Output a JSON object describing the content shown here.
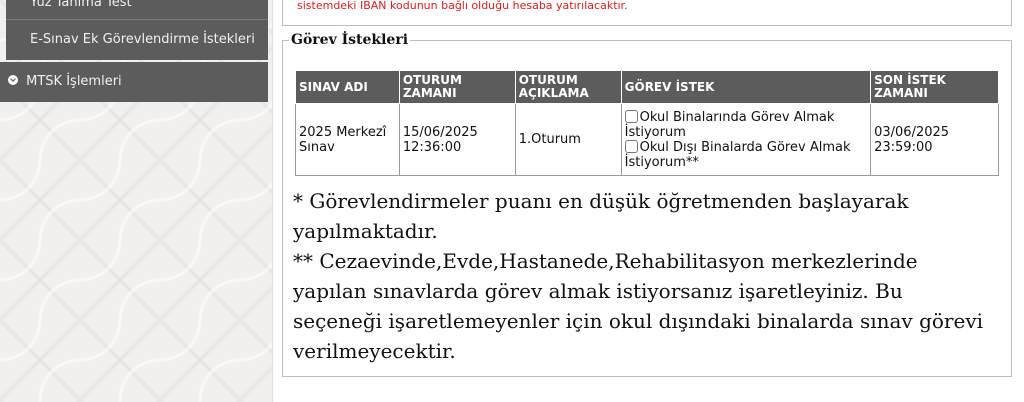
{
  "sidebar": {
    "items": [
      {
        "label": "Yüz Tanıma Test"
      },
      {
        "label": "E-Sınav Ek Görevlendirme İstekleri"
      }
    ],
    "mtsk": {
      "label": "MTSK İşlemleri"
    }
  },
  "notice": {
    "text": "sistemdeki IBAN kodunun bağlı olduğu hesaba yatırılacaktır."
  },
  "gorev_istekleri": {
    "legend": "Görev İstekleri",
    "columns": [
      "SINAV ADI",
      "OTURUM ZAMANI",
      "OTURUM AÇIKLAMA",
      "GÖREV İSTEK",
      "SON İSTEK ZAMANI"
    ],
    "rows": [
      {
        "sinav_adi": "2025 Merkezî Sınav",
        "oturum_zamani": "15/06/2025 12:36:00",
        "oturum_aciklama": "1.Oturum",
        "options": [
          {
            "label": "Okul Binalarında Görev Almak İstiyorum",
            "checked": false
          },
          {
            "label": "Okul Dışı Binalarda Görev Almak İstiyorum**",
            "checked": false
          }
        ],
        "son_istek_zamani": "03/06/2025 23:59:00"
      }
    ]
  },
  "notes": {
    "note1": "* Görevlendirmeler puanı en düşük öğretmenden başlayarak yapılmaktadır.",
    "note2": "** Cezaevinde,Evde,Hastanede,Rehabilitasyon merkezlerinde yapılan sınavlarda görev almak istiyorsanız işaretleyiniz. Bu seçeneği işaretlemeyenler için okul dışındaki binalarda sınav görevi verilmeyecektir."
  },
  "colors": {
    "menu_bg": "#5c5c5c",
    "header_bg": "#5c5c5c",
    "notice_red": "#d42020"
  }
}
